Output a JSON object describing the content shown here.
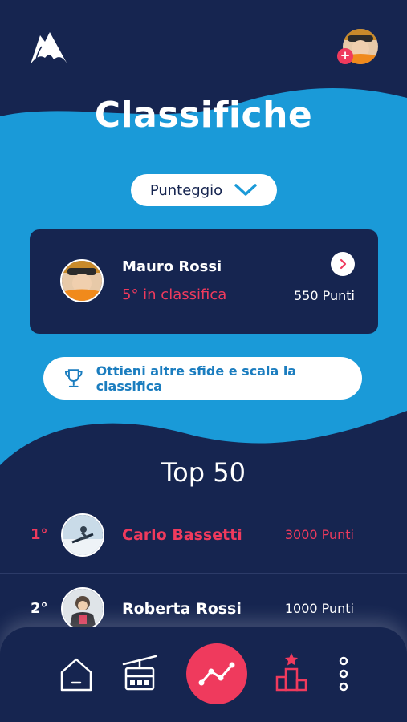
{
  "header": {
    "title": "Classifiche",
    "logo_icon": "mountain-logo-icon",
    "avatar_badge": "+"
  },
  "filter": {
    "selected": "Punteggio",
    "icon": "chevron-down-icon"
  },
  "current_user": {
    "name": "Mauro Rossi",
    "rank_text": "5° in classifica",
    "points": "550 Punti"
  },
  "cta": {
    "label": "Ottieni altre sfide e scala la classifica",
    "icon": "trophy-icon"
  },
  "leaderboard": {
    "title": "Top 50",
    "rows": [
      {
        "rank": "1°",
        "name": "Carlo Bassetti",
        "points": "3000 Punti"
      },
      {
        "rank": "2°",
        "name": "Roberta Rossi",
        "points": "1000 Punti"
      }
    ]
  },
  "nav": {
    "items": [
      "home-icon",
      "cable-car-icon",
      "stats-icon",
      "podium-icon",
      "more-icon"
    ],
    "active": "podium-icon"
  },
  "colors": {
    "navy": "#162550",
    "blue": "#1a9ad8",
    "accent": "#ef3a5d",
    "white": "#ffffff"
  }
}
